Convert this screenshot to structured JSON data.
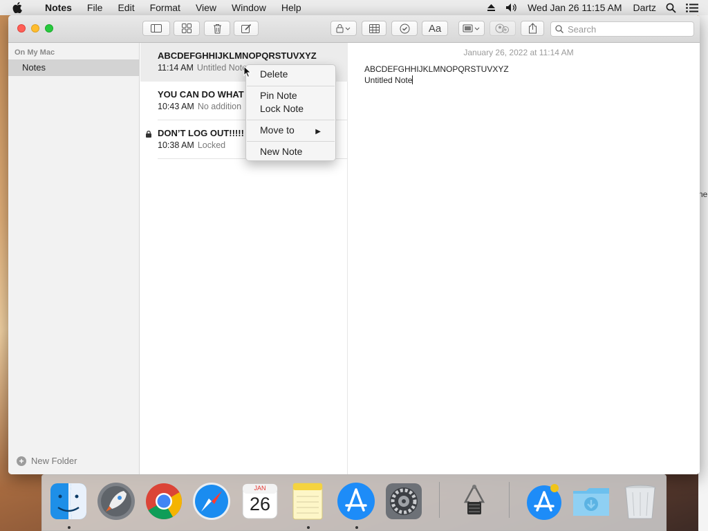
{
  "menubar": {
    "app_name": "Notes",
    "menus": [
      "File",
      "Edit",
      "Format",
      "View",
      "Window",
      "Help"
    ],
    "clock": "Wed Jan 26  11:15 AM",
    "user": "Dartz"
  },
  "toolbar": {
    "search_placeholder": "Search"
  },
  "sidebar": {
    "section_header": "On My Mac",
    "folder": "Notes",
    "new_folder_label": "New Folder"
  },
  "notes": [
    {
      "title": "ABCDEFGHHIJKLMNOPQRSTUVXYZ",
      "time": "11:14 AM",
      "preview": "Untitled Note",
      "locked": false,
      "selected": true
    },
    {
      "title": "YOU CAN DO WHAT",
      "time": "10:43 AM",
      "preview": "No addition",
      "locked": false,
      "selected": false
    },
    {
      "title": "DON’T LOG OUT!!!!!",
      "time": "10:38 AM",
      "preview": "Locked",
      "locked": true,
      "selected": false
    }
  ],
  "editor": {
    "date": "January 26, 2022 at 11:14 AM",
    "line1": "ABCDEFGHHIJKLMNOPQRSTUVXYZ",
    "line2": "Untitled Note"
  },
  "context_menu": {
    "delete": "Delete",
    "pin": "Pin Note",
    "lock": "Lock Note",
    "move_to": "Move to",
    "new_note": "New Note"
  },
  "dock": {
    "calendar_month": "JAN",
    "calendar_day": "26"
  },
  "background_fragment": "ne",
  "colors": {
    "selection_gray": "#d3d3d3",
    "close": "#ff5f56",
    "minimize": "#ffbd2e",
    "maximize": "#27c93f"
  }
}
